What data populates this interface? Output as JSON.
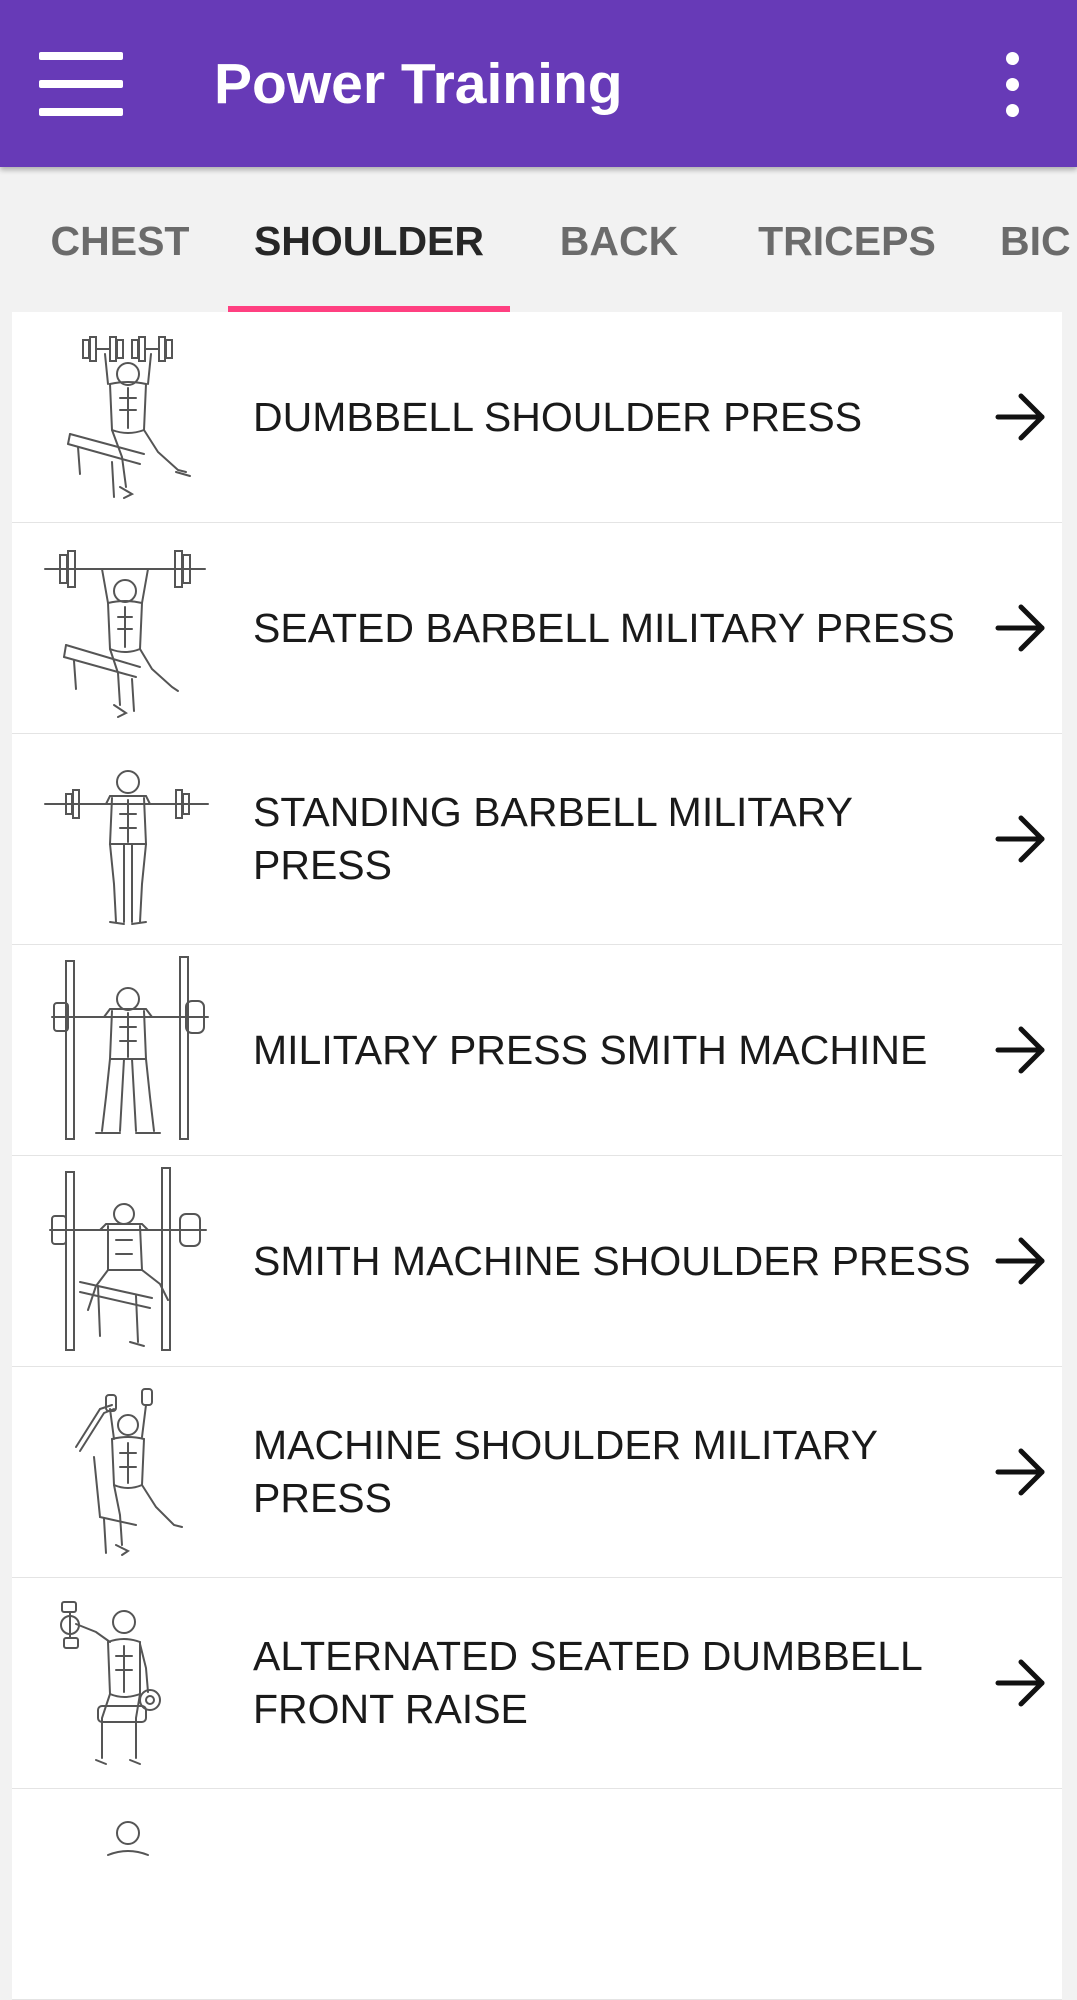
{
  "app": {
    "title": "Power Training",
    "menu_icon": "hamburger-menu-icon",
    "overflow_icon": "more-vertical-icon"
  },
  "colors": {
    "appbar": "#673ab7",
    "tab_indicator": "#ff4081",
    "active_tab_text": "#262626",
    "inactive_tab_text": "#6b6b6b",
    "row_background": "#ffffff",
    "page_background": "#f2f2f2"
  },
  "tabs": [
    {
      "label": "CHEST",
      "selected": false
    },
    {
      "label": "SHOULDER",
      "selected": true
    },
    {
      "label": "BACK",
      "selected": false
    },
    {
      "label": "TRICEPS",
      "selected": false
    },
    {
      "label": "BIC",
      "selected": false
    }
  ],
  "exercises": [
    {
      "label": "DUMBBELL SHOULDER PRESS",
      "thumbnail": "seated-dumbbell-press-figure",
      "action_icon": "arrow-right-icon"
    },
    {
      "label": "SEATED BARBELL MILITARY PRESS",
      "thumbnail": "seated-barbell-press-figure",
      "action_icon": "arrow-right-icon"
    },
    {
      "label": "STANDING BARBELL MILITARY PRESS",
      "thumbnail": "standing-barbell-press-figure",
      "action_icon": "arrow-right-icon"
    },
    {
      "label": "MILITARY PRESS SMITH MACHINE",
      "thumbnail": "smith-machine-standing-figure",
      "action_icon": "arrow-right-icon"
    },
    {
      "label": "SMITH MACHINE SHOULDER PRESS",
      "thumbnail": "smith-machine-seated-figure",
      "action_icon": "arrow-right-icon"
    },
    {
      "label": "MACHINE SHOULDER MILITARY PRESS",
      "thumbnail": "machine-press-figure",
      "action_icon": "arrow-right-icon"
    },
    {
      "label": "ALTERNATED SEATED DUMBBELL FRONT RAISE",
      "thumbnail": "seated-front-raise-figure",
      "action_icon": "arrow-right-icon"
    },
    {
      "label": "",
      "thumbnail": "partial-figure",
      "action_icon": ""
    }
  ]
}
